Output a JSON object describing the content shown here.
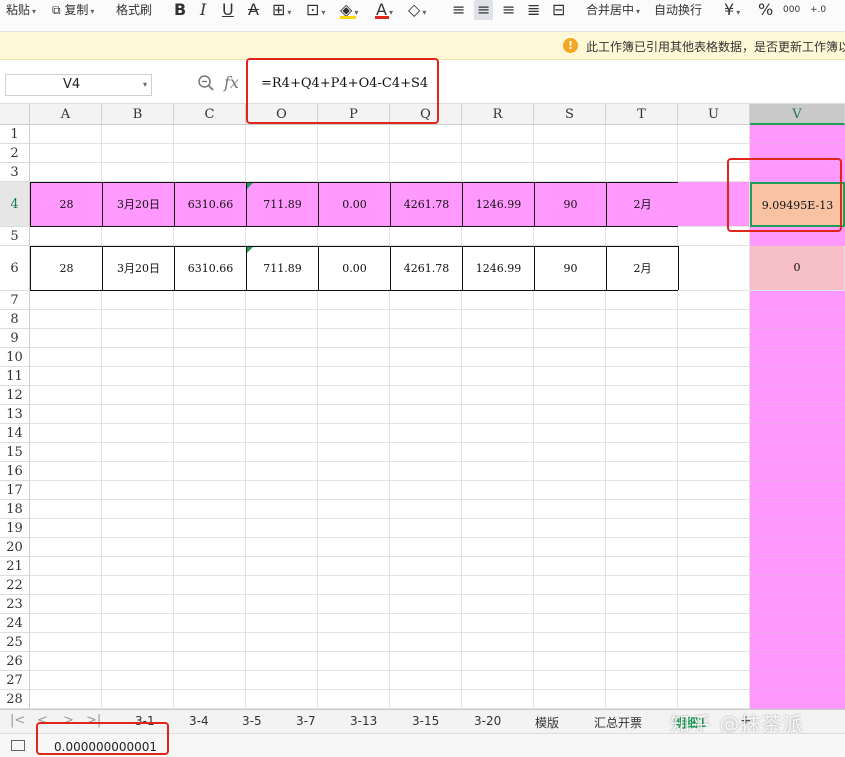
{
  "toolbar": {
    "paste": "粘贴",
    "copy": "复制",
    "format_painter": "格式刷",
    "bold": "B",
    "italic": "I",
    "underline": "U",
    "strike": "A",
    "font_color_letter": "A",
    "merge_center": "合并居中",
    "wrap_text": "自动换行",
    "currency": "¥",
    "percent": "%",
    "thousands": "000",
    "decimal": "+.0",
    "font_color": "#e0261b",
    "fill_color": "#ffd700"
  },
  "notice": {
    "icon": "!",
    "text": "此工作簿已引用其他表格数据，是否更新工作簿以"
  },
  "formula_bar": {
    "cell_ref": "V4",
    "fx_label": "fx",
    "formula": "=R4+Q4+P4+O4-C4+S4"
  },
  "columns": [
    "A",
    "B",
    "C",
    "O",
    "P",
    "Q",
    "R",
    "S",
    "T",
    "U",
    "V"
  ],
  "rows": [
    "1",
    "2",
    "3",
    "4",
    "5",
    "6",
    "7",
    "8",
    "9",
    "10",
    "11",
    "12",
    "13",
    "14",
    "15",
    "16",
    "17",
    "18",
    "19",
    "20",
    "21",
    "22",
    "23",
    "24",
    "25",
    "26",
    "27",
    "28"
  ],
  "data_rows": {
    "row4": {
      "A": "28",
      "B": "3月20日",
      "C": "6310.66",
      "O": "711.89",
      "P": "0.00",
      "Q": "4261.78",
      "R": "1246.99",
      "S": "90",
      "T": "2月",
      "V": "9.09495E-13"
    },
    "row6": {
      "A": "28",
      "B": "3月20日",
      "C": "6310.66",
      "O": "711.89",
      "P": "0.00",
      "Q": "4261.78",
      "R": "1246.99",
      "S": "90",
      "T": "2月",
      "V": "0"
    }
  },
  "sheet_tabs": [
    "3-1",
    "3-4",
    "3-5",
    "3-7",
    "3-13",
    "3-15",
    "3-20",
    "模版",
    "汇总开票",
    "明细1"
  ],
  "watermark": "知乎 @抹茶派",
  "status": {
    "sum_value": "0.000000000001"
  },
  "colors": {
    "highlight_pink": "#ff99ff",
    "active_cell": "#f8c3a3",
    "row6_v": "#f7c0c8",
    "selection_green": "#1f9e5a",
    "annotation_red": "#e0261b"
  }
}
